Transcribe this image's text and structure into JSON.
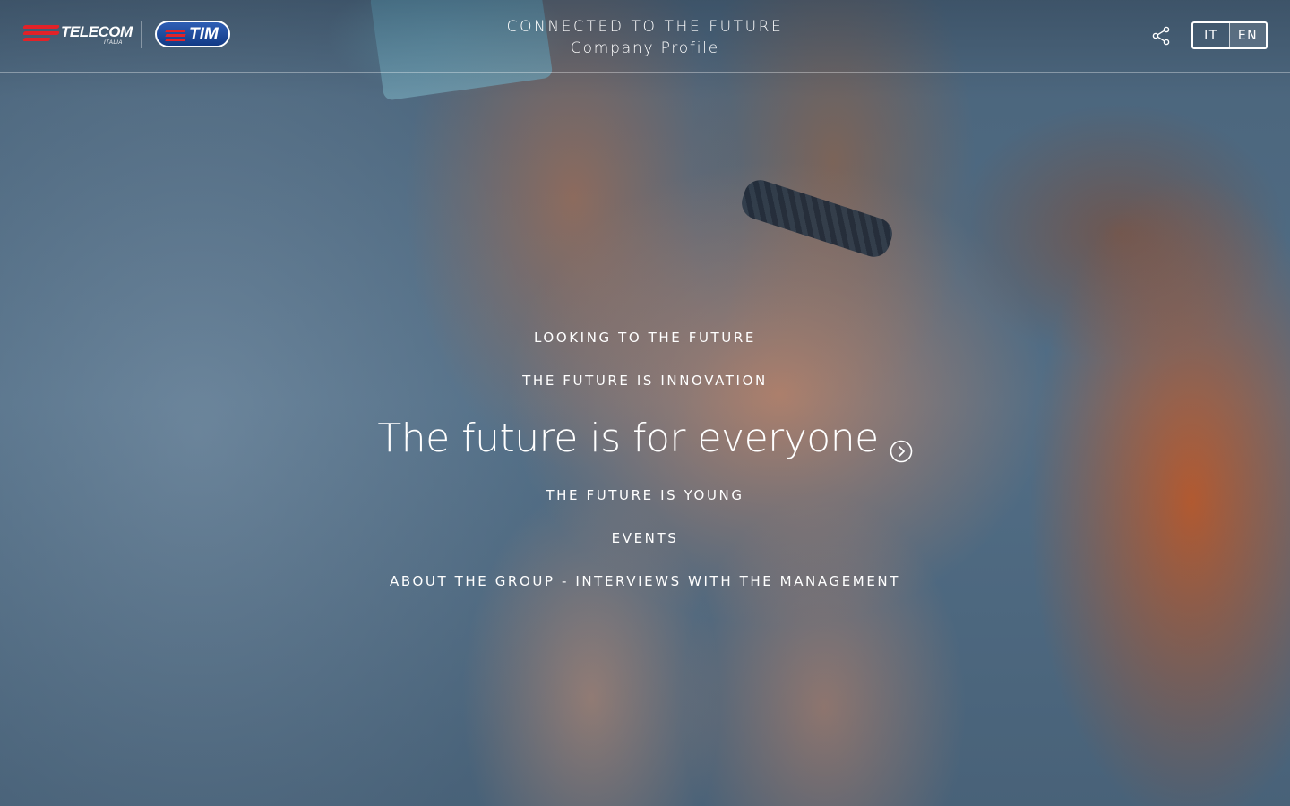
{
  "header": {
    "logos": {
      "telecom": "TELECOM",
      "telecom_sub": "ITALIA",
      "tim": "TIM"
    },
    "title_line1": "CONNECTED TO THE FUTURE",
    "title_line2": "Company Profile",
    "share_icon": "share-icon",
    "languages": [
      {
        "label": "IT",
        "active": false
      },
      {
        "label": "EN",
        "active": true
      }
    ]
  },
  "menu": {
    "items": [
      {
        "label": "LOOKING TO THE FUTURE",
        "featured": false
      },
      {
        "label": "THE FUTURE IS INNOVATION",
        "featured": false
      },
      {
        "label": "The future is for everyone",
        "featured": true,
        "icon": "chevron-right-circle-icon"
      },
      {
        "label": "THE FUTURE IS YOUNG",
        "featured": false
      },
      {
        "label": "EVENTS",
        "featured": false
      },
      {
        "label": "ABOUT THE GROUP - INTERVIEWS WITH THE MANAGEMENT",
        "featured": false
      }
    ]
  },
  "colors": {
    "brand_red": "#e32228",
    "brand_blue": "#123a86",
    "text": "#ffffff"
  }
}
